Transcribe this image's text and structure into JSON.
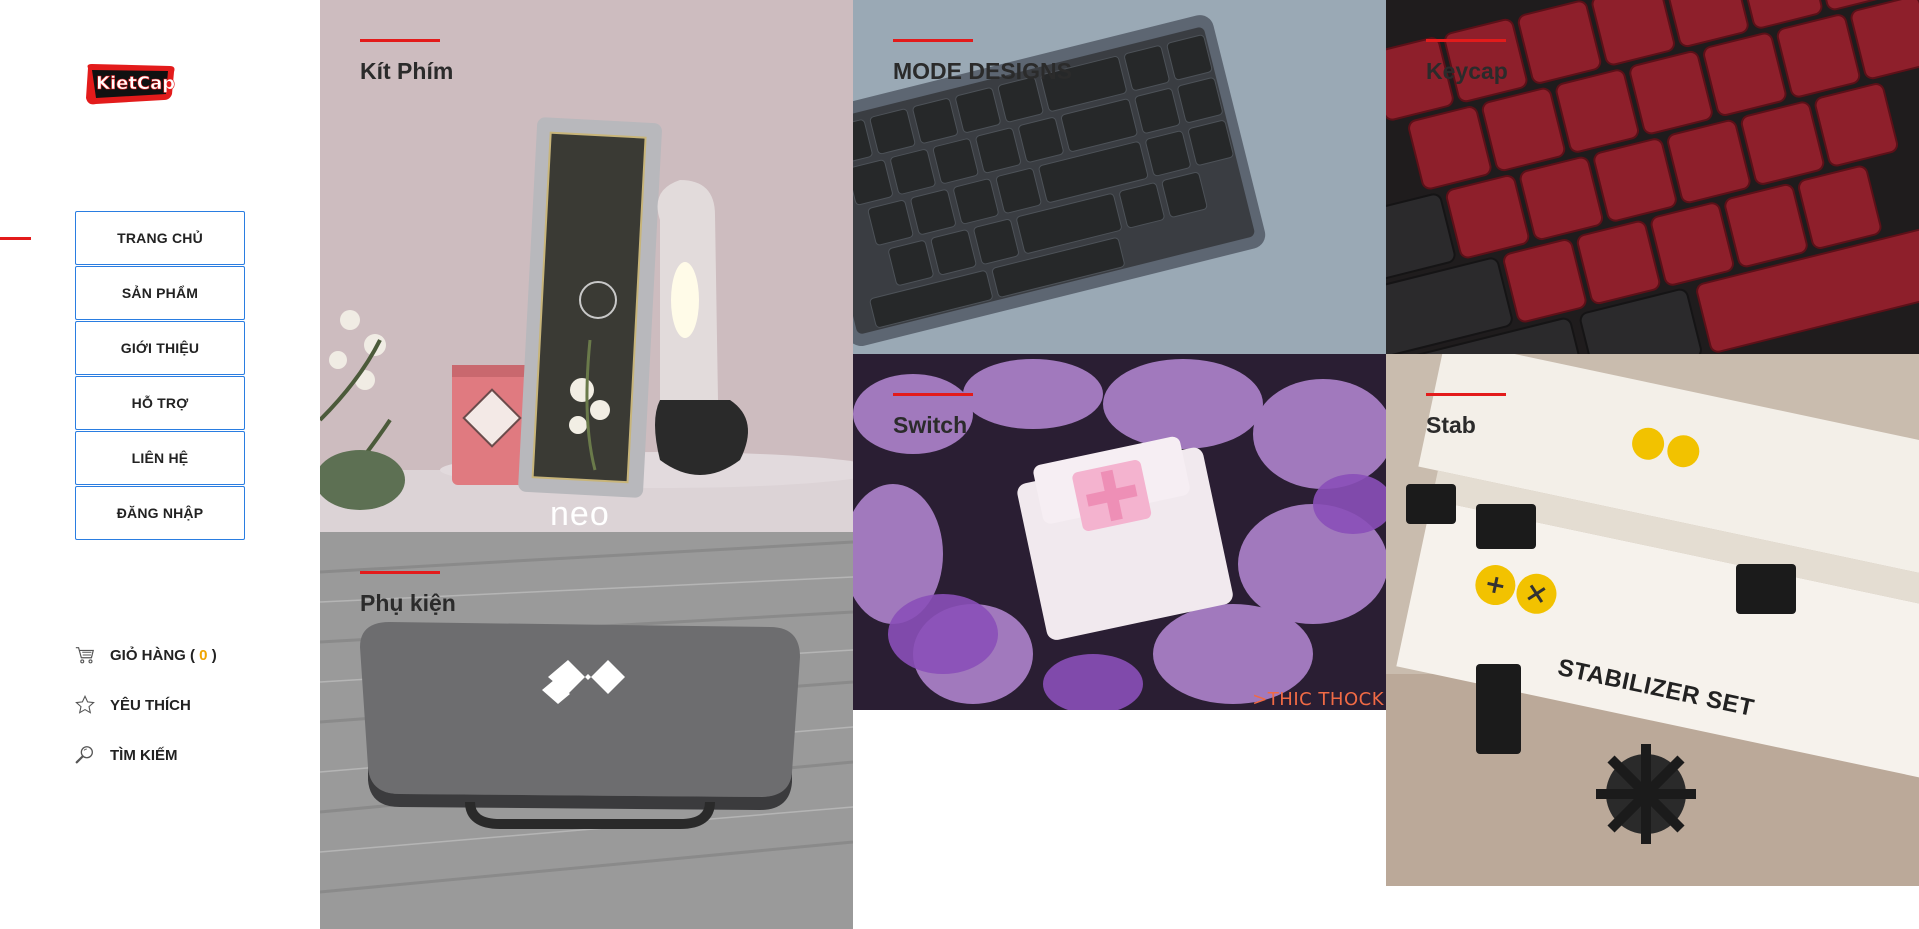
{
  "brand": {
    "logo_text": "KietCap"
  },
  "nav": {
    "items": [
      {
        "label": "TRANG CHỦ"
      },
      {
        "label": "SẢN PHẨM"
      },
      {
        "label": "GIỚI THIỆU"
      },
      {
        "label": "HỖ TRỢ"
      },
      {
        "label": "LIÊN HỆ"
      },
      {
        "label": "ĐĂNG NHẬP"
      }
    ]
  },
  "utility": {
    "cart": {
      "label": "GIỎ HÀNG (",
      "count": "0",
      "close": ")"
    },
    "favorites": {
      "label": "YÊU THÍCH"
    },
    "search": {
      "label": "TÌM KIẾM"
    }
  },
  "categories": [
    {
      "title": "Kít Phím",
      "watermark": "neo"
    },
    {
      "title": "MODE DESIGNS"
    },
    {
      "title": "Keycap"
    },
    {
      "title": "Phụ kiện"
    },
    {
      "title": "Switch",
      "watermark": ">THIC THOCK"
    },
    {
      "title": "Stab",
      "box_text": "STABILIZER SET"
    }
  ],
  "colors": {
    "accent": "#e31b1b",
    "nav_border": "#2a7de1",
    "cart_count": "#f0a500"
  }
}
